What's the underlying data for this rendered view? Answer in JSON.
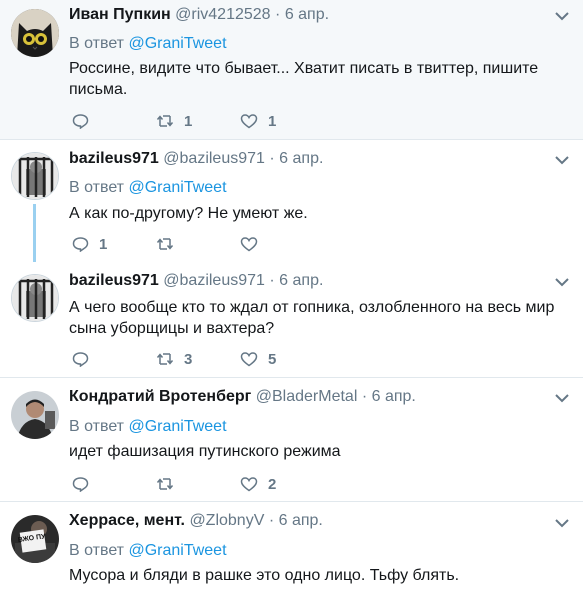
{
  "tweets": [
    {
      "name": "Иван Пупкин",
      "handle": "@riv4212528",
      "dot": "·",
      "date": "6 апр.",
      "reply_prefix": "В ответ",
      "reply_mention": "@GraniTweet",
      "text": "Россине, видите что бывает... Хватит писать в твиттер, пишите письма.",
      "replies": "",
      "retweets": "1",
      "likes": "1",
      "avatar": "black-cat-avatar"
    },
    {
      "name": "bazileus971",
      "handle": "@bazileus971",
      "dot": "·",
      "date": "6 апр.",
      "reply_prefix": "В ответ",
      "reply_mention": "@GraniTweet",
      "text": "А как по-другому? Не умеют же.",
      "replies": "1",
      "retweets": "",
      "likes": "",
      "avatar": "prison-bars-avatar"
    },
    {
      "name": "bazileus971",
      "handle": "@bazileus971",
      "dot": "·",
      "date": "6 апр.",
      "text": "А чего вообще кто то ждал от гопника, озлобленного на весь мир сына уборщицы и вахтера?",
      "replies": "",
      "retweets": "3",
      "likes": "5",
      "avatar": "prison-bars-avatar"
    },
    {
      "name": "Кондратий Вротенберг",
      "handle": "@BladerMetal",
      "dot": "·",
      "date": "6 апр.",
      "reply_prefix": "В ответ",
      "reply_mention": "@GraniTweet",
      "text": "идет фашизация путинского режима",
      "replies": "",
      "retweets": "",
      "likes": "2",
      "avatar": "person-photo-avatar"
    },
    {
      "name": "Херрасе, мент.",
      "handle": "@ZlobnyV",
      "dot": "·",
      "date": "6 апр.",
      "reply_prefix": "В ответ",
      "reply_mention": "@GraniTweet",
      "text": "Мусора и бляди в рашке это одно лицо. Тьфу блять.",
      "avatar": "sign-photo-avatar",
      "avatar_sign_text": "ВЖО ПУ"
    }
  ],
  "colors": {
    "link": "#1b95e0",
    "secondary": "#657786",
    "divider": "#e1e8ed",
    "highlight_bg": "#f5f8fa",
    "thread_line": "#9ad0f0"
  }
}
